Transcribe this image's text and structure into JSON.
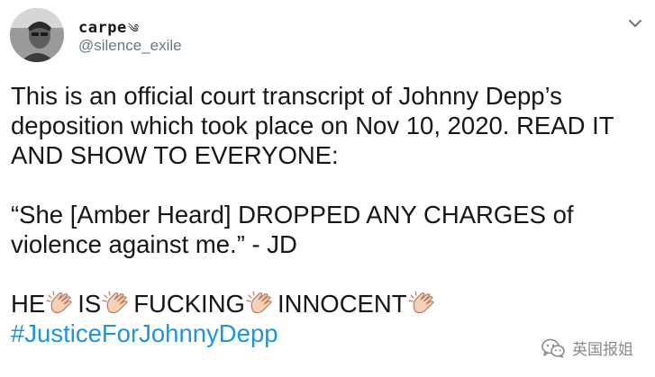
{
  "user": {
    "display_name": "carpe",
    "display_name_symbol": "༄",
    "handle": "@silence_exile"
  },
  "tweet": {
    "line1": "This is an official court transcript of Johnny Depp’s",
    "line2": "deposition which took place on Nov 10, 2020. READ IT",
    "line3": "AND SHOW TO EVERYONE:",
    "quote_line1": "“She [Amber Heard] DROPPED ANY CHARGES of",
    "quote_line2": "violence against me.” - JD",
    "shout": [
      "HE",
      "IS",
      "FUCKING",
      "INNOCENT"
    ],
    "hashtag": "#JusticeForJohnnyDepp"
  },
  "icons": {
    "avatar": "avatar-photo",
    "more": "chevron-down-icon",
    "emoji": "clapping-hands-icon",
    "watermark": "wechat-icon"
  },
  "watermark": {
    "text": "英国报姐"
  },
  "colors": {
    "text": "#14171a",
    "secondary": "#657786",
    "link": "#1b95e0",
    "emoji_skin": "#f7d0b7",
    "emoji_outline": "#b27b62"
  }
}
